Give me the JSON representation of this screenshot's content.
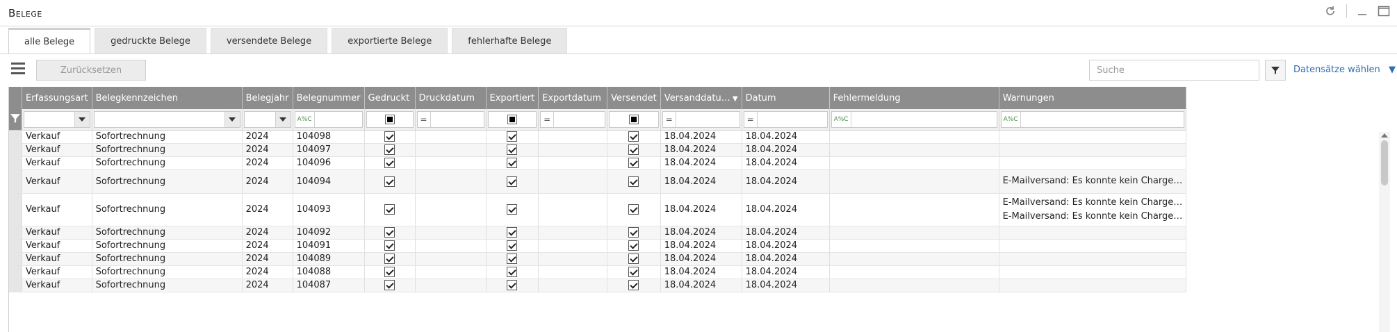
{
  "window": {
    "title": "Belege"
  },
  "tabs": [
    {
      "label": "alle Belege",
      "active": true
    },
    {
      "label": "gedruckte Belege",
      "active": false
    },
    {
      "label": "versendete Belege",
      "active": false
    },
    {
      "label": "exportierte Belege",
      "active": false
    },
    {
      "label": "fehlerhafte Belege",
      "active": false
    }
  ],
  "toolbar": {
    "reset_label": "Zurücksetzen",
    "search_placeholder": "Suche",
    "datasets_label": "Datensätze wählen"
  },
  "columns": [
    "Erfassungsart",
    "Belegkennzeichen",
    "Belegjahr",
    "Belegnummer",
    "Gedruckt",
    "Druckdatum",
    "Exportiert",
    "Exportdatum",
    "Versendet",
    "Versanddatu…",
    "Datum",
    "Fehlermeldung",
    "Warnungen"
  ],
  "filter_operator": "A%C",
  "rows": [
    {
      "art": "Verkauf",
      "kz": "Sofortrechnung",
      "jahr": "2024",
      "nr": "104098",
      "gedruckt": true,
      "druckdatum": "",
      "exportiert": true,
      "exportdatum": "",
      "versendet": true,
      "versanddatum": "18.04.2024",
      "datum": "18.04.2024",
      "fehler": "",
      "warnungen": []
    },
    {
      "art": "Verkauf",
      "kz": "Sofortrechnung",
      "jahr": "2024",
      "nr": "104097",
      "gedruckt": true,
      "druckdatum": "",
      "exportiert": true,
      "exportdatum": "",
      "versendet": true,
      "versanddatum": "18.04.2024",
      "datum": "18.04.2024",
      "fehler": "",
      "warnungen": []
    },
    {
      "art": "Verkauf",
      "kz": "Sofortrechnung",
      "jahr": "2024",
      "nr": "104096",
      "gedruckt": true,
      "druckdatum": "",
      "exportiert": true,
      "exportdatum": "",
      "versendet": true,
      "versanddatum": "18.04.2024",
      "datum": "18.04.2024",
      "fehler": "",
      "warnungen": []
    },
    {
      "art": "Verkauf",
      "kz": "Sofortrechnung",
      "jahr": "2024",
      "nr": "104094",
      "gedruckt": true,
      "druckdatum": "",
      "exportiert": true,
      "exportdatum": "",
      "versendet": true,
      "versanddatum": "18.04.2024",
      "datum": "18.04.2024",
      "fehler": "",
      "warnungen": [
        "E-Mailversand: Es konnte kein Charge…"
      ]
    },
    {
      "art": "Verkauf",
      "kz": "Sofortrechnung",
      "jahr": "2024",
      "nr": "104093",
      "gedruckt": true,
      "druckdatum": "",
      "exportiert": true,
      "exportdatum": "",
      "versendet": true,
      "versanddatum": "18.04.2024",
      "datum": "18.04.2024",
      "fehler": "",
      "warnungen": [
        "E-Mailversand: Es konnte kein Charge…",
        "E-Mailversand: Es konnte kein Charge…"
      ]
    },
    {
      "art": "Verkauf",
      "kz": "Sofortrechnung",
      "jahr": "2024",
      "nr": "104092",
      "gedruckt": true,
      "druckdatum": "",
      "exportiert": true,
      "exportdatum": "",
      "versendet": true,
      "versanddatum": "18.04.2024",
      "datum": "18.04.2024",
      "fehler": "",
      "warnungen": []
    },
    {
      "art": "Verkauf",
      "kz": "Sofortrechnung",
      "jahr": "2024",
      "nr": "104091",
      "gedruckt": true,
      "druckdatum": "",
      "exportiert": true,
      "exportdatum": "",
      "versendet": true,
      "versanddatum": "18.04.2024",
      "datum": "18.04.2024",
      "fehler": "",
      "warnungen": []
    },
    {
      "art": "Verkauf",
      "kz": "Sofortrechnung",
      "jahr": "2024",
      "nr": "104089",
      "gedruckt": true,
      "druckdatum": "",
      "exportiert": true,
      "exportdatum": "",
      "versendet": true,
      "versanddatum": "18.04.2024",
      "datum": "18.04.2024",
      "fehler": "",
      "warnungen": []
    },
    {
      "art": "Verkauf",
      "kz": "Sofortrechnung",
      "jahr": "2024",
      "nr": "104088",
      "gedruckt": true,
      "druckdatum": "",
      "exportiert": true,
      "exportdatum": "",
      "versendet": true,
      "versanddatum": "18.04.2024",
      "datum": "18.04.2024",
      "fehler": "",
      "warnungen": []
    },
    {
      "art": "Verkauf",
      "kz": "Sofortrechnung",
      "jahr": "2024",
      "nr": "104087",
      "gedruckt": true,
      "druckdatum": "",
      "exportiert": true,
      "exportdatum": "",
      "versendet": true,
      "versanddatum": "18.04.2024",
      "datum": "18.04.2024",
      "fehler": "",
      "warnungen": []
    }
  ],
  "colors": {
    "accent": "#2f6eb5",
    "header_bg": "#8d8d8d"
  },
  "icons": [
    "refresh-icon",
    "minimize-icon",
    "maximize-icon",
    "hamburger-menu-icon",
    "filter-icon",
    "dropdown-arrow-icon",
    "sort-desc-icon"
  ]
}
